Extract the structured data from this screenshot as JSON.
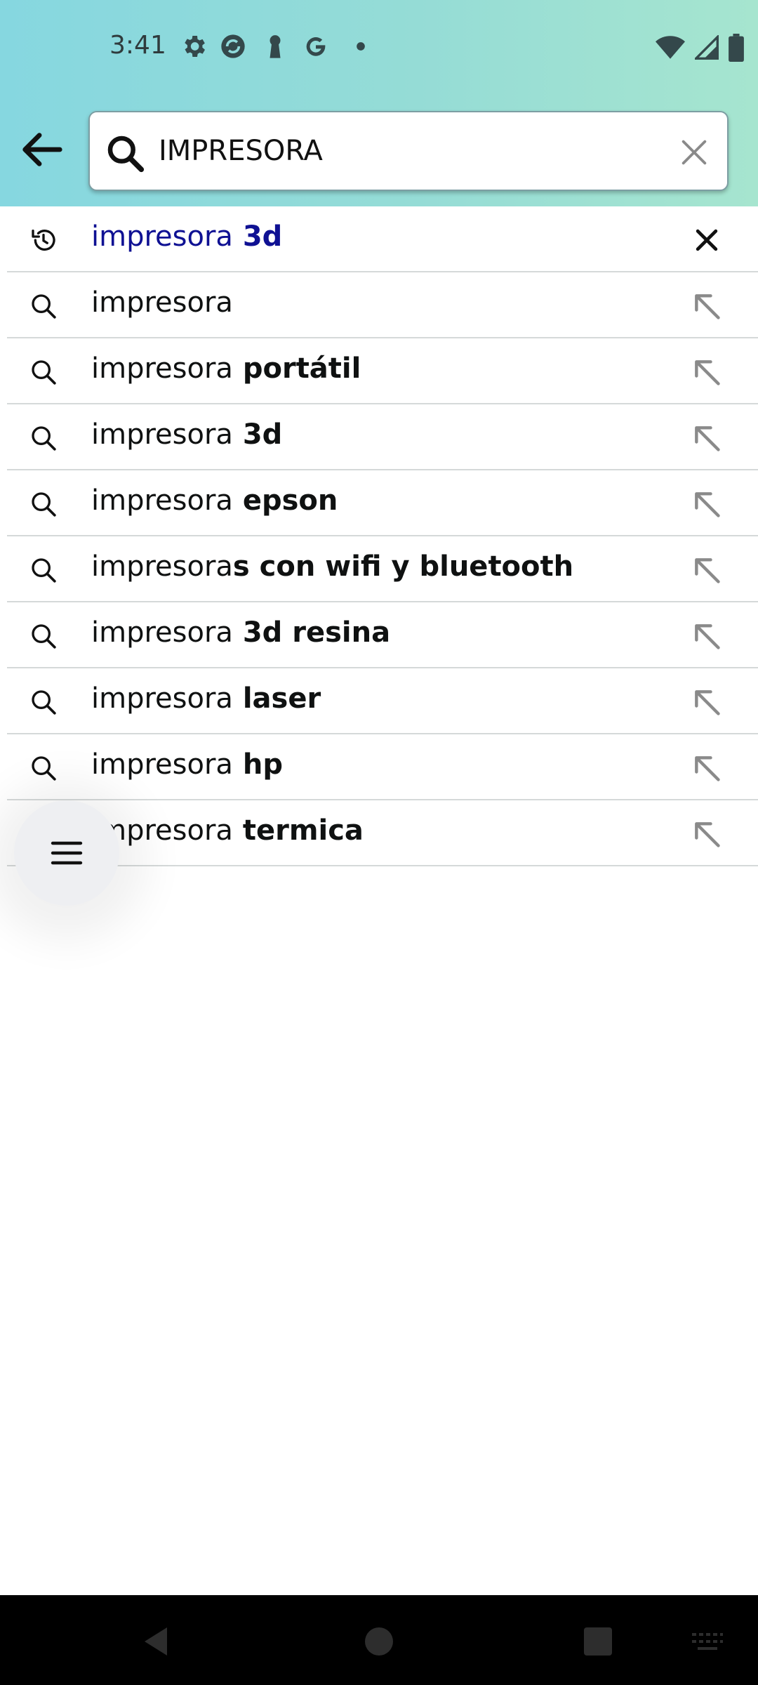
{
  "status_bar": {
    "time": "3:41",
    "left_icons": [
      "gear-icon",
      "sync-icon",
      "keyhole-icon",
      "google-icon",
      "dot-icon"
    ],
    "right_icons": [
      "wifi-icon",
      "signal-icon",
      "battery-icon"
    ]
  },
  "search": {
    "value": "IMPRESORA",
    "back_icon": "arrow-left-icon",
    "search_icon": "search-icon",
    "clear_icon": "close-icon"
  },
  "suggestions": [
    {
      "type": "history",
      "prefix": "impresora",
      "bold": " 3d"
    },
    {
      "type": "query",
      "prefix": "impresora",
      "bold": ""
    },
    {
      "type": "query",
      "prefix": "impresora",
      "bold": " portátil"
    },
    {
      "type": "query",
      "prefix": "impresora",
      "bold": " 3d"
    },
    {
      "type": "query",
      "prefix": "impresora",
      "bold": " epson"
    },
    {
      "type": "query",
      "prefix": "impresora",
      "bold": "s con wifi y bluetooth"
    },
    {
      "type": "query",
      "prefix": "impresora",
      "bold": " 3d resina"
    },
    {
      "type": "query",
      "prefix": "impresora",
      "bold": " laser"
    },
    {
      "type": "query",
      "prefix": "impresora",
      "bold": " hp"
    },
    {
      "type": "query",
      "prefix": "impresora",
      "bold": " termica"
    }
  ],
  "fab": {
    "icon": "menu-icon"
  },
  "colors": {
    "header_start": "#86d7e0",
    "header_end": "#a6e5cf",
    "history_text": "#0f1193",
    "divider": "#d5d9d9"
  }
}
